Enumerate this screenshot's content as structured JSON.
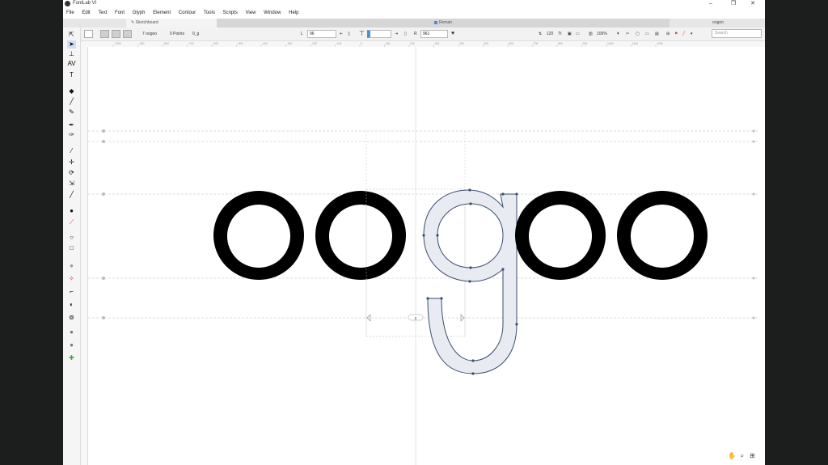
{
  "app": {
    "title": "FontLab VI"
  },
  "window_controls": {
    "minimize": "–",
    "restore": "❐",
    "close": "✕"
  },
  "menu": [
    "File",
    "Edit",
    "Text",
    "Font",
    "Glyph",
    "Element",
    "Contour",
    "Tools",
    "Scripts",
    "View",
    "Window",
    "Help"
  ],
  "tabs": {
    "sketchboard": "Sketchboard",
    "font": "Roman",
    "right_panel": "oogoo"
  },
  "properties": {
    "glyph_text": "7 oogoo",
    "points": "0 Points",
    "glyph_name": "0_g",
    "lsb_label": "L",
    "lsb_value": "96",
    "rsb_label": "R",
    "rsb_value": "961",
    "font_size": "120",
    "zoom": "100%",
    "search_placeholder": "Search"
  },
  "text_string": "oogoo",
  "glyph_label": "g",
  "ruler_ticks": [
    "-1000",
    "-900",
    "-800",
    "-700",
    "-600",
    "-500",
    "-400",
    "-300",
    "-200",
    "-100",
    "0",
    "100",
    "200",
    "300",
    "400",
    "500",
    "600",
    "700",
    "800",
    "900",
    "1000",
    "1100",
    "1200"
  ],
  "colors": {
    "accent": "#4a8fd8",
    "glyph_fill": "#000000",
    "selected_fill": "#e8ecf2",
    "selected_stroke": "#3a4d6e"
  },
  "icons": {
    "tools": [
      "contour-select-icon",
      "select-icon",
      "text-edit-icon",
      "kerning-icon",
      "text-icon",
      "eraser-icon",
      "brush-icon",
      "pencil-icon",
      "pen-icon",
      "rapid-pen-icon",
      "knife-icon",
      "guide-icon",
      "rotate-icon",
      "scale-icon",
      "ruler-icon",
      "fill-icon",
      "eyedropper-icon",
      "ellipse-icon",
      "rectangle-icon",
      "grayscale-icon",
      "stamp-icon",
      "corner-icon",
      "contrast-icon",
      "components-icon",
      "circle-tool-icon",
      "number-tool-icon",
      "anchor-green-icon"
    ],
    "bottom": [
      "hand-icon",
      "zoom-icon",
      "zoom-fit-icon"
    ]
  }
}
